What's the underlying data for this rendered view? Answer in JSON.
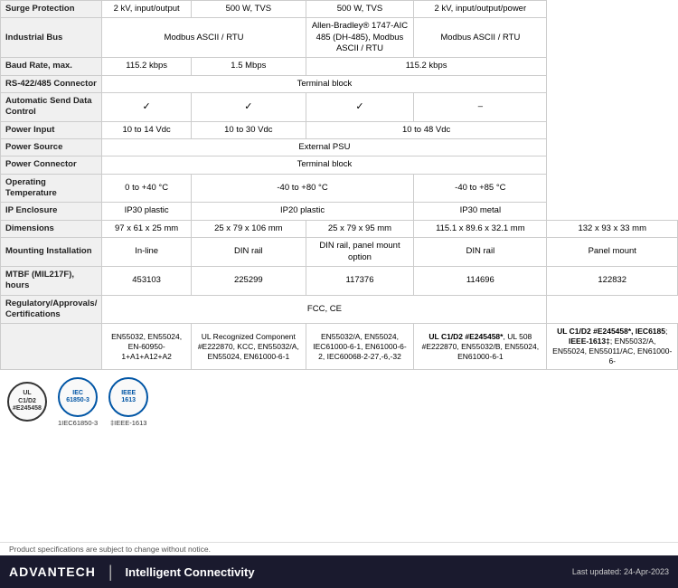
{
  "table": {
    "rows": [
      {
        "label": "Surge Protection",
        "cells": [
          "2 kV, input/output",
          "500 W, TVS",
          "500 W, TVS",
          "2 kV, input/output/power"
        ]
      },
      {
        "label": "Industrial Bus",
        "cells": [
          "Modbus ASCII / RTU",
          "",
          "Allen-Bradley® 1747-AIC 485 (DH-485), Modbus ASCII / RTU",
          "Modbus ASCII / RTU"
        ]
      },
      {
        "label": "Baud Rate, max.",
        "cells": [
          "115.2 kbps",
          "1.5 Mbps",
          "115.2 kbps",
          ""
        ]
      },
      {
        "label": "RS-422/485 Connector",
        "cells": [
          "Terminal block",
          "",
          "",
          ""
        ]
      },
      {
        "label": "Automatic Send Data Control",
        "cells": [
          "✓",
          "✓",
          "✓",
          "–"
        ]
      },
      {
        "label": "Power Input",
        "cells": [
          "10 to 14  Vdc",
          "10 to 30 Vdc",
          "10 to 48 Vdc",
          ""
        ]
      },
      {
        "label": "Power Source",
        "cells": [
          "External PSU",
          "",
          "",
          ""
        ]
      },
      {
        "label": "Power Connector",
        "cells": [
          "Terminal block",
          "",
          "",
          ""
        ]
      },
      {
        "label": "Operating Temperature",
        "cells": [
          "0 to +40 °C",
          "-40 to +80 °C",
          "-40 to +85 °C",
          ""
        ]
      },
      {
        "label": "IP Enclosure",
        "cells": [
          "IP30 plastic",
          "IP20 plastic",
          "IP30 metal",
          ""
        ]
      },
      {
        "label": "Dimensions",
        "cells": [
          "97 x 61 x 25 mm",
          "25 x 79 x 106 mm",
          "25 x 79 x 95 mm",
          "115.1 x 89.6 x 32.1 mm",
          "132 x 93 x 33 mm"
        ]
      },
      {
        "label": "Mounting Installation",
        "cells": [
          "In-line",
          "DIN rail",
          "DIN rail, panel mount option",
          "DIN rail",
          "Panel mount"
        ]
      },
      {
        "label": "MTBF (MIL217F), hours",
        "cells": [
          "453103",
          "225299",
          "117376",
          "114696",
          "122832"
        ]
      },
      {
        "label": "Regulatory/Approvals/ Certifications",
        "cells_html": true,
        "cells": [
          "EN55032, EN55024, EN-60950-1+A1+A12+A2",
          "UL Recognized Component #E222870, KCC, EN55032/A, EN55024, EN61000-6-1",
          "EN55032/A, EN55024, IEC61000-6-1, EN61000-6-2, IEC60068-2-27,-6,-32",
          "UL C1/D2 #E245458*, UL 508 #E222870, EN55032/B, EN55024, EN61000-6-1",
          "UL C1/D2 #E245458*, IEC61850; IEEE-1613‡; EN55032/A, EN55024, EN55011/AC, EN61000-6-"
        ]
      }
    ],
    "fcc_row": "FCC, CE"
  },
  "cert_logos": [
    {
      "id": "ul-d1d2",
      "line1": "UL",
      "line2": "C1/D2",
      "sub": "#E245458",
      "label": "1IEC61850-3"
    },
    {
      "id": "iec61850",
      "line1": "IEC",
      "line2": "61850-3",
      "label": "1IEC61850-3"
    },
    {
      "id": "ieee1613",
      "line1": "IEEE",
      "line2": "1613",
      "label": "‡IEEE-1613"
    }
  ],
  "footer": {
    "brand": "ADVANTECH",
    "tagline": "Intelligent Connectivity",
    "note": "Product specifications are subject to change without notice.",
    "last_updated": "Last updated: 24-Apr-2023"
  }
}
